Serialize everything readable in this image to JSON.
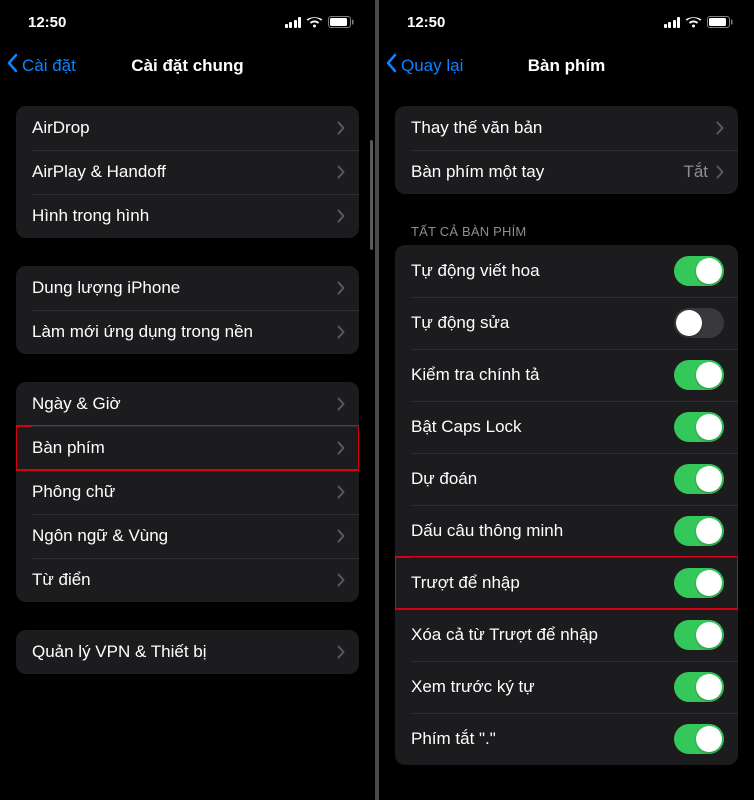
{
  "status": {
    "time": "12:50"
  },
  "left": {
    "back": "Cài đặt",
    "title": "Cài đặt chung",
    "groups": [
      {
        "items": [
          {
            "label": "AirDrop",
            "type": "nav"
          },
          {
            "label": "AirPlay & Handoff",
            "type": "nav"
          },
          {
            "label": "Hình trong hình",
            "type": "nav"
          }
        ]
      },
      {
        "items": [
          {
            "label": "Dung lượng iPhone",
            "type": "nav"
          },
          {
            "label": "Làm mới ứng dụng trong nền",
            "type": "nav"
          }
        ]
      },
      {
        "items": [
          {
            "label": "Ngày & Giờ",
            "type": "nav"
          },
          {
            "label": "Bàn phím",
            "type": "nav",
            "highlight": true
          },
          {
            "label": "Phông chữ",
            "type": "nav"
          },
          {
            "label": "Ngôn ngữ & Vùng",
            "type": "nav"
          },
          {
            "label": "Từ điển",
            "type": "nav"
          }
        ]
      },
      {
        "items": [
          {
            "label": "Quản lý VPN & Thiết bị",
            "type": "nav"
          }
        ]
      }
    ]
  },
  "right": {
    "back": "Quay lại",
    "title": "Bàn phím",
    "topGroup": [
      {
        "label": "Thay thế văn bản",
        "type": "nav"
      },
      {
        "label": "Bàn phím một tay",
        "type": "detail",
        "detail": "Tắt"
      }
    ],
    "sectionHeader": "TẤT CẢ BÀN PHÍM",
    "toggles": [
      {
        "label": "Tự động viết hoa",
        "on": true
      },
      {
        "label": "Tự động sửa",
        "on": false
      },
      {
        "label": "Kiểm tra chính tả",
        "on": true
      },
      {
        "label": "Bật Caps Lock",
        "on": true
      },
      {
        "label": "Dự đoán",
        "on": true
      },
      {
        "label": "Dấu câu thông minh",
        "on": true
      },
      {
        "label": "Trượt để nhập",
        "on": true,
        "highlight": true
      },
      {
        "label": "Xóa cả từ Trượt để nhập",
        "on": true
      },
      {
        "label": "Xem trước ký tự",
        "on": true
      },
      {
        "label": "Phím tắt \".\"",
        "on": true
      }
    ]
  }
}
